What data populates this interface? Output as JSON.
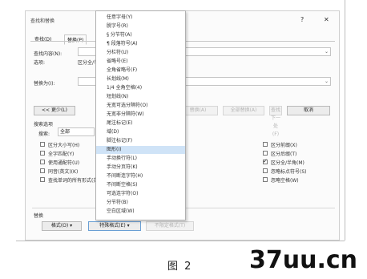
{
  "dialog": {
    "title": "查找和替换",
    "help": "?",
    "close": "✕",
    "tabs": [
      "查找(D)",
      "替换(P)"
    ],
    "find_label": "查找内容(N):",
    "options_label": "选项:",
    "options_value": "区分全/半角",
    "replace_label": "替换为(I):",
    "less_button": "<< 更少(L)",
    "buttons_right": [
      "替换(A)",
      "全部替换(A)",
      "查找下一处(F)",
      "取消"
    ],
    "search_options_header": "搜索选项",
    "search_label": "搜索:",
    "search_value": "全部",
    "checkboxes_left": [
      {
        "label": "区分大小写(H)",
        "checked": false
      },
      {
        "label": "全字匹配(Y)",
        "checked": false
      },
      {
        "label": "使用通配符(U)",
        "checked": false
      },
      {
        "label": "同音(英文)(K)",
        "checked": false
      },
      {
        "label": "查找单词的所有形式(英文)(W)",
        "checked": false
      }
    ],
    "checkboxes_right": [
      {
        "label": "区分前缀(X)",
        "checked": false
      },
      {
        "label": "区分后缀(T)",
        "checked": false
      },
      {
        "label": "区分全/半角(M)",
        "checked": true
      },
      {
        "label": "忽略标点符号(S)",
        "checked": false
      },
      {
        "label": "忽略空格(W)",
        "checked": false
      }
    ],
    "replace_section_label": "替换",
    "format_button": "格式(O) ▾",
    "special_button": "特殊格式(E) ▾",
    "no_format_button": "不限定格式(T)"
  },
  "menu": {
    "items": [
      "任意字母(Y)",
      "脱字号(R)",
      "§ 分节符(A)",
      "¶ 段落符号(A)",
      "分栏符(U)",
      "省略号(E)",
      "全角省略号(F)",
      "长划线(M)",
      "1/4 全角空格(4)",
      "短划线(N)",
      "无宽可选分隔符(O)",
      "无宽非分隔符(W)",
      "尾注标记(E)",
      "域(D)",
      "脚注标记(F)",
      "图形(I)",
      "手动换行符(L)",
      "手动分页符(K)",
      "不间断连字符(H)",
      "不间断空格(S)",
      "可选连字符(O)",
      "分节符(B)",
      "空白区域(W)"
    ],
    "highlighted_index": 15
  },
  "caption": "图 2",
  "watermark": "37uu.cn"
}
